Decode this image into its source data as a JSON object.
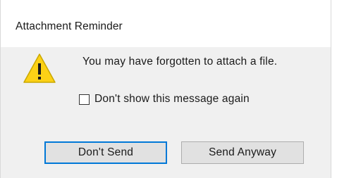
{
  "dialog": {
    "title": "Attachment Reminder",
    "icon": "warning-triangle-icon",
    "message": "You may have forgotten to attach a file.",
    "checkbox": {
      "label": "Don't show this message again",
      "checked": false
    },
    "buttons": {
      "dont_send": "Don't Send",
      "send_anyway": "Send Anyway"
    },
    "colors": {
      "warning_fill": "#fcd116",
      "warning_border": "#c9a800",
      "default_button_border": "#0078d7",
      "content_background": "#f0f0f0"
    }
  }
}
